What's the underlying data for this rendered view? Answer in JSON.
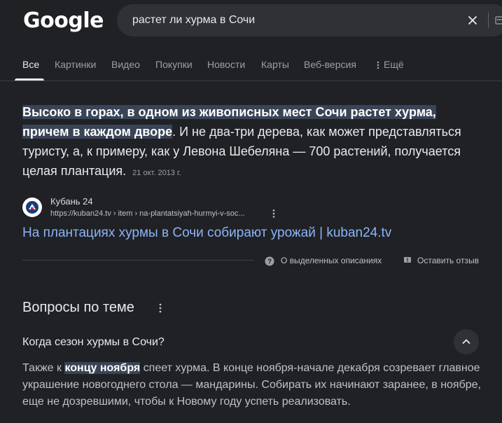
{
  "logo": "Google",
  "search": {
    "query": "растет ли хурма в Сочи"
  },
  "tabs": [
    {
      "label": "Все",
      "active": true
    },
    {
      "label": "Картинки"
    },
    {
      "label": "Видео"
    },
    {
      "label": "Покупки"
    },
    {
      "label": "Новости"
    },
    {
      "label": "Карты"
    },
    {
      "label": "Веб-версия"
    },
    {
      "label": "Ещё"
    }
  ],
  "snippet": {
    "highlight": "Высоко в горах, в одном из живописных мест Сочи растет хурма, причем в каждом дворе",
    "rest": ". И не два-три дерева, как может представляться туристу, а, к примеру, как у Левона Шебеляна — 700 растений, получается целая плантация.",
    "date": "21 окт. 2013 г."
  },
  "source": {
    "name": "Кубань 24",
    "url": "https://kuban24.tv › item › na-plantatsiyah-hurmyi-v-soc...",
    "link_title": "На плантациях хурмы в Сочи собирают урожай | kuban24.tv"
  },
  "feedback": {
    "about": "О выделенных описаниях",
    "leave": "Оставить отзыв"
  },
  "paa": {
    "title": "Вопросы по теме",
    "question": "Когда сезон хурмы в Сочи?",
    "answer_pre": "Также к ",
    "answer_hl": "концу ноября",
    "answer_post": " спеет хурма. В конце ноября-начале декабря созревает главное украшение новогоднего стола — мандарины. Собирать их начинают заранее, в ноябре, еще не дозревшими, чтобы к Новому году успеть реализовать."
  },
  "colors": {
    "background": "#202124",
    "link": "#8ab4f8",
    "highlight": "#394457"
  }
}
